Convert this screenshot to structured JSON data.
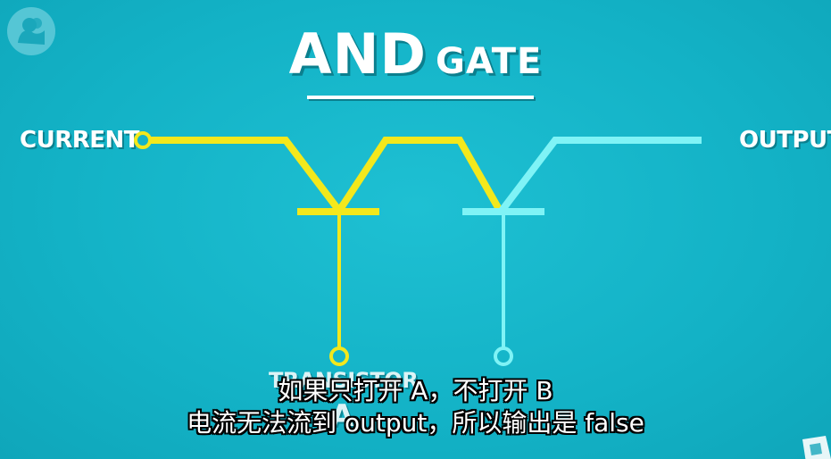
{
  "title": {
    "main": "AND",
    "sub": "GATE"
  },
  "labels": {
    "current": "CURRENT",
    "output": "OUTPUT",
    "transistor": "TRANSISTOR",
    "transistor_letter": "A"
  },
  "subtitles": {
    "line1": "如果只打开 A，不打开 B",
    "line2": "电流无法流到 output，所以输出是 false"
  },
  "colors": {
    "background": "#14b3c7",
    "wire_active": "#f3e81c",
    "wire_inactive": "#7ff3f6",
    "text": "#ffffff"
  },
  "icons": {
    "logo": "pbs-logo-icon",
    "corner": "watermark-corner-icon"
  }
}
